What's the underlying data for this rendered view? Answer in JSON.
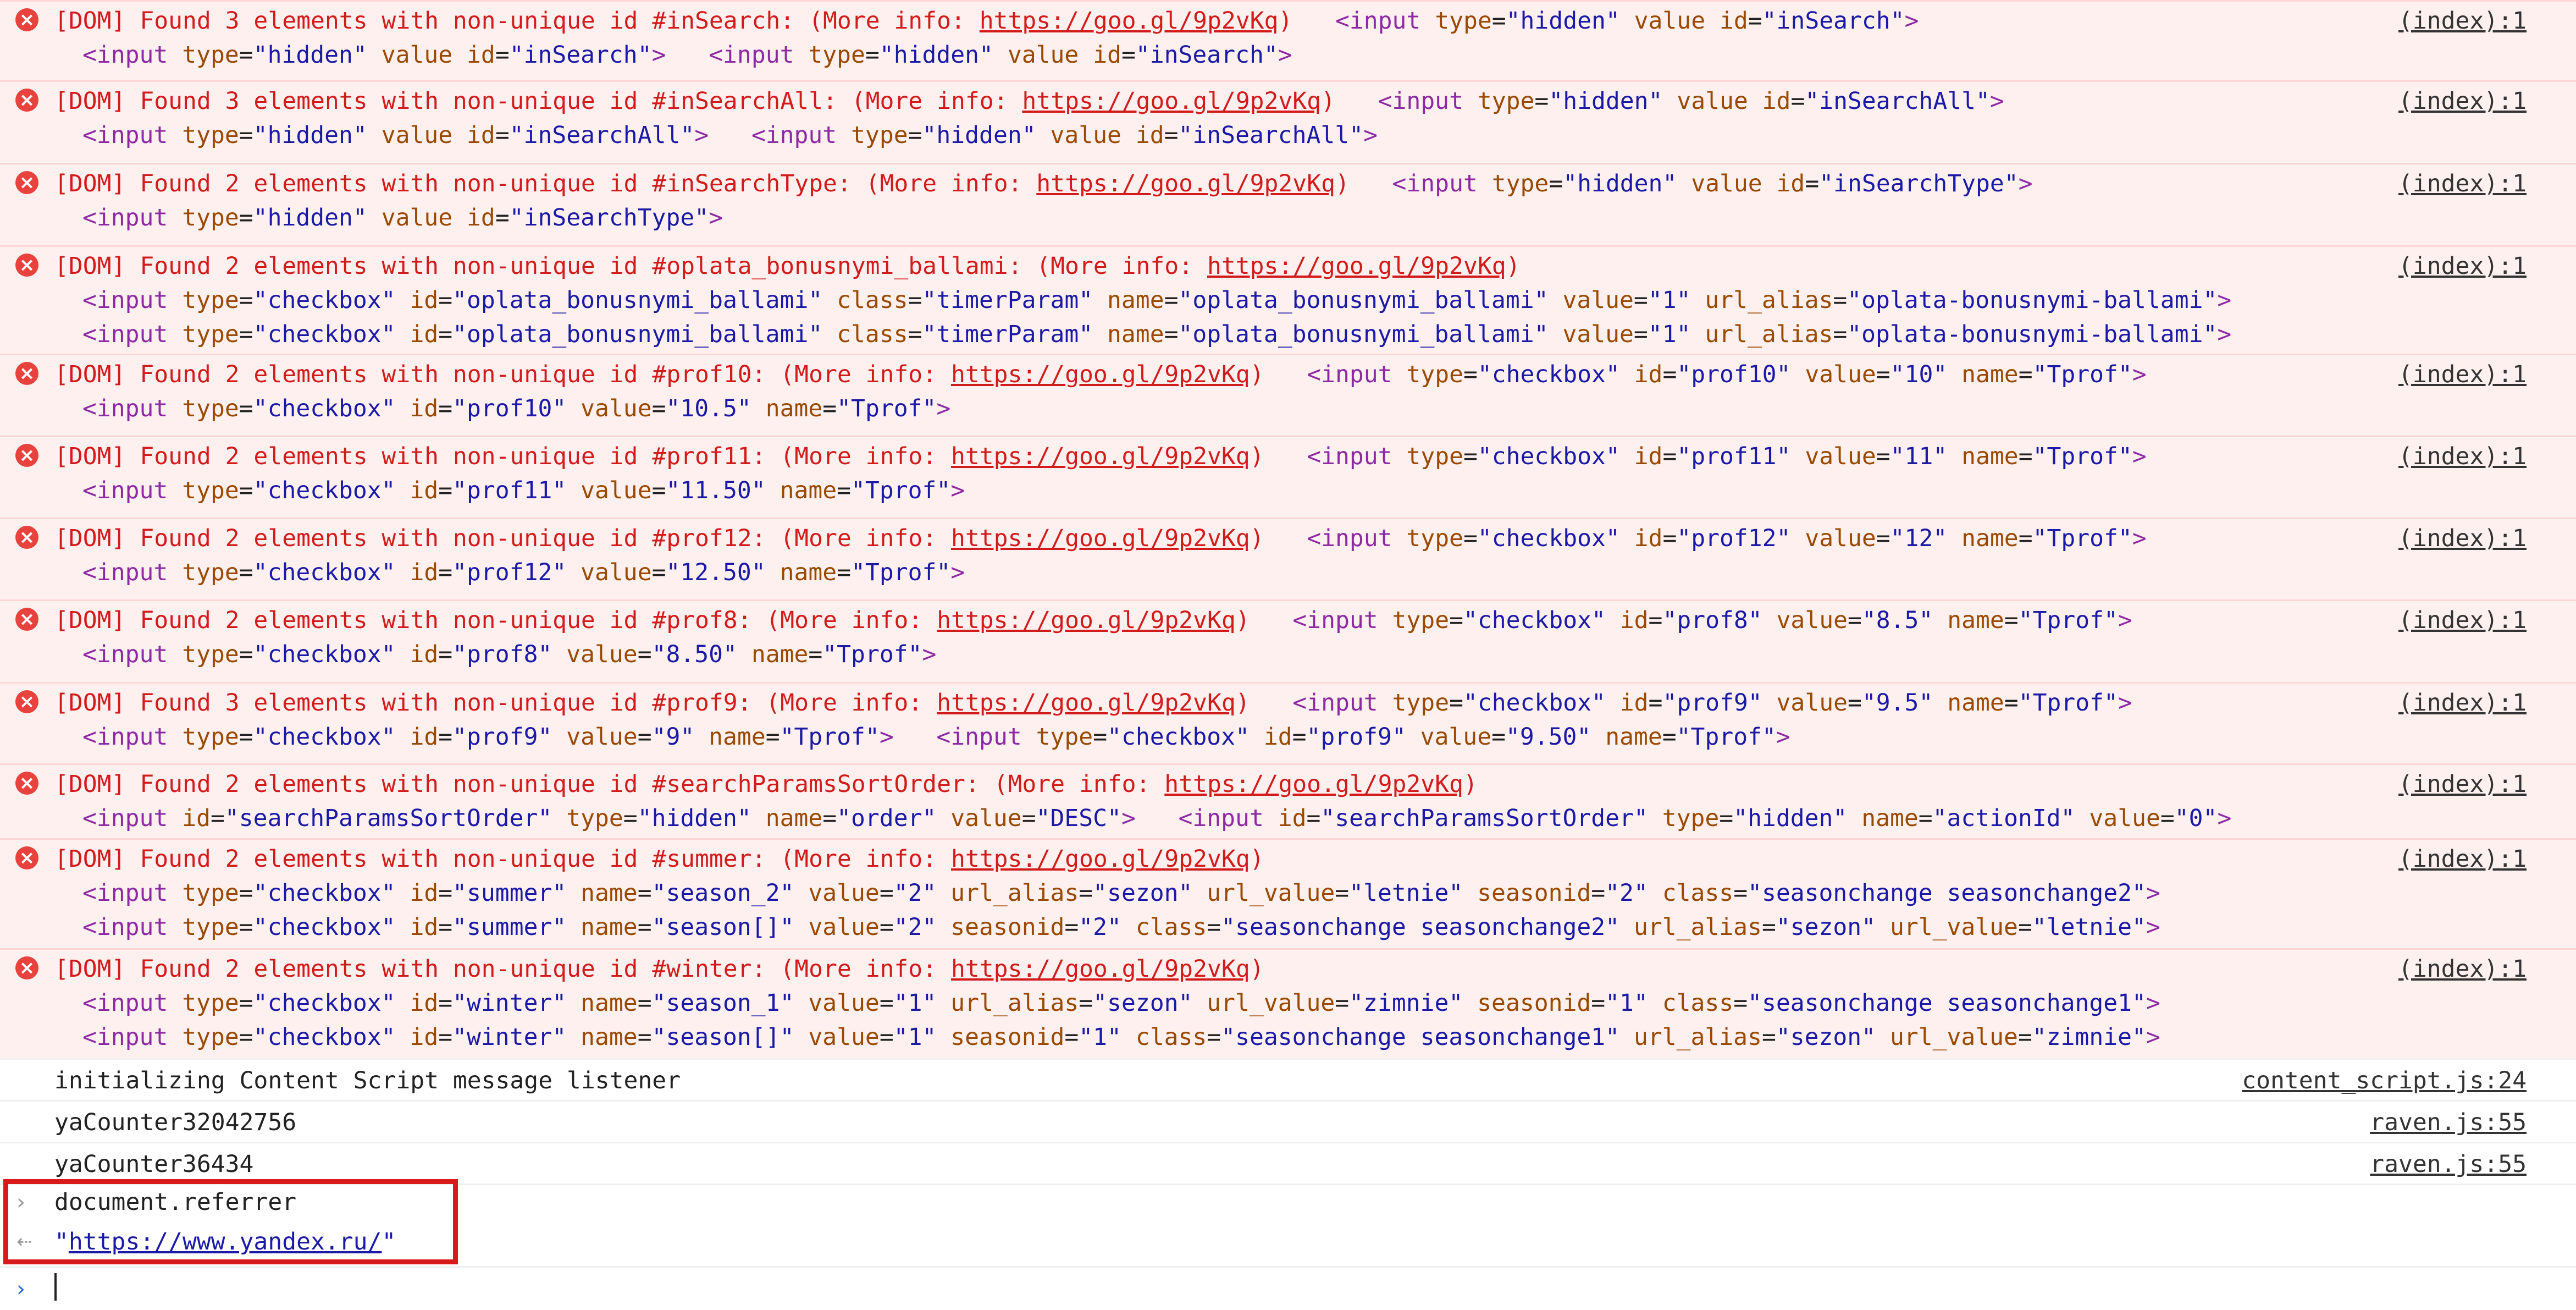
{
  "console": {
    "errors": [
      {
        "lines": [
          "[DOM] Found 3 elements with non-unique id #inSearch: (More info: https://goo.gl/9p2vKq)   <input type=\"hidden\" value id=\"inSearch\">",
          "<input type=\"hidden\" value id=\"inSearch\">   <input type=\"hidden\" value id=\"inSearch\">"
        ],
        "source": "(index):1"
      },
      {
        "lines": [
          "[DOM] Found 3 elements with non-unique id #inSearchAll: (More info: https://goo.gl/9p2vKq)   <input type=\"hidden\" value id=\"inSearchAll\">",
          "<input type=\"hidden\" value id=\"inSearchAll\">   <input type=\"hidden\" value id=\"inSearchAll\">"
        ],
        "source": "(index):1"
      },
      {
        "lines": [
          "[DOM] Found 2 elements with non-unique id #inSearchType: (More info: https://goo.gl/9p2vKq)   <input type=\"hidden\" value id=\"inSearchType\">",
          "<input type=\"hidden\" value id=\"inSearchType\">"
        ],
        "source": "(index):1"
      },
      {
        "lines": [
          "[DOM] Found 2 elements with non-unique id #oplata_bonusnymi_ballami: (More info: https://goo.gl/9p2vKq)",
          "<input type=\"checkbox\" id=\"oplata_bonusnymi_ballami\" class=\"timerParam\" name=\"oplata_bonusnymi_ballami\" value=\"1\" url_alias=\"oplata-bonusnymi-ballami\">",
          "<input type=\"checkbox\" id=\"oplata_bonusnymi_ballami\" class=\"timerParam\" name=\"oplata_bonusnymi_ballami\" value=\"1\" url_alias=\"oplata-bonusnymi-ballami\">"
        ],
        "source": "(index):1"
      },
      {
        "lines": [
          "[DOM] Found 2 elements with non-unique id #prof10: (More info: https://goo.gl/9p2vKq)   <input type=\"checkbox\" id=\"prof10\" value=\"10\" name=\"Tprof\">",
          "<input type=\"checkbox\" id=\"prof10\" value=\"10.5\" name=\"Tprof\">"
        ],
        "source": "(index):1"
      },
      {
        "lines": [
          "[DOM] Found 2 elements with non-unique id #prof11: (More info: https://goo.gl/9p2vKq)   <input type=\"checkbox\" id=\"prof11\" value=\"11\" name=\"Tprof\">",
          "<input type=\"checkbox\" id=\"prof11\" value=\"11.50\" name=\"Tprof\">"
        ],
        "source": "(index):1"
      },
      {
        "lines": [
          "[DOM] Found 2 elements with non-unique id #prof12: (More info: https://goo.gl/9p2vKq)   <input type=\"checkbox\" id=\"prof12\" value=\"12\" name=\"Tprof\">",
          "<input type=\"checkbox\" id=\"prof12\" value=\"12.50\" name=\"Tprof\">"
        ],
        "source": "(index):1"
      },
      {
        "lines": [
          "[DOM] Found 2 elements with non-unique id #prof8: (More info: https://goo.gl/9p2vKq)   <input type=\"checkbox\" id=\"prof8\" value=\"8.5\" name=\"Tprof\">",
          "<input type=\"checkbox\" id=\"prof8\" value=\"8.50\" name=\"Tprof\">"
        ],
        "source": "(index):1"
      },
      {
        "lines": [
          "[DOM] Found 3 elements with non-unique id #prof9: (More info: https://goo.gl/9p2vKq)   <input type=\"checkbox\" id=\"prof9\" value=\"9.5\" name=\"Tprof\">",
          "<input type=\"checkbox\" id=\"prof9\" value=\"9\" name=\"Tprof\">   <input type=\"checkbox\" id=\"prof9\" value=\"9.50\" name=\"Tprof\">"
        ],
        "source": "(index):1"
      },
      {
        "lines": [
          "[DOM] Found 2 elements with non-unique id #searchParamsSortOrder: (More info: https://goo.gl/9p2vKq)",
          "<input id=\"searchParamsSortOrder\" type=\"hidden\" name=\"order\" value=\"DESC\">   <input id=\"searchParamsSortOrder\" type=\"hidden\" name=\"actionId\" value=\"0\">"
        ],
        "source": "(index):1"
      },
      {
        "lines": [
          "[DOM] Found 2 elements with non-unique id #summer: (More info: https://goo.gl/9p2vKq)",
          "<input type=\"checkbox\" id=\"summer\" name=\"season_2\" value=\"2\" url_alias=\"sezon\" url_value=\"letnie\" seasonid=\"2\" class=\"seasonchange seasonchange2\">",
          "<input type=\"checkbox\" id=\"summer\" name=\"season[]\" value=\"2\" seasonid=\"2\" class=\"seasonchange seasonchange2\" url_alias=\"sezon\" url_value=\"letnie\">"
        ],
        "source": "(index):1"
      },
      {
        "lines": [
          "[DOM] Found 2 elements with non-unique id #winter: (More info: https://goo.gl/9p2vKq)",
          "<input type=\"checkbox\" id=\"winter\" name=\"season_1\" value=\"1\" url_alias=\"sezon\" url_value=\"zimnie\" seasonid=\"1\" class=\"seasonchange seasonchange1\">",
          "<input type=\"checkbox\" id=\"winter\" name=\"season[]\" value=\"1\" seasonid=\"1\" class=\"seasonchange seasonchange1\" url_alias=\"sezon\" url_value=\"zimnie\">"
        ],
        "source": "(index):1"
      }
    ],
    "logs": [
      {
        "text": "initializing Content Script message listener",
        "source": "content_script.js:24"
      },
      {
        "text": "yaCounter32042756",
        "source": "raven.js:55"
      },
      {
        "text": "yaCounter36434",
        "source": "raven.js:55"
      }
    ],
    "evaluation": {
      "input": "document.referrer",
      "result": "\"https://www.yandex.ru/\""
    },
    "prompt_value": "",
    "colors": {
      "error_bg": "#fff0f0",
      "error_text": "#d21c1c",
      "error_icon": "#e8423f",
      "highlight_border": "#d81a1a",
      "prompt_arrow": "#2a6ad6"
    },
    "icons": {
      "error": "error-circle-x-icon",
      "input_prompt": "chevron-right-icon",
      "result_prompt": "return-arrow-icon"
    }
  }
}
